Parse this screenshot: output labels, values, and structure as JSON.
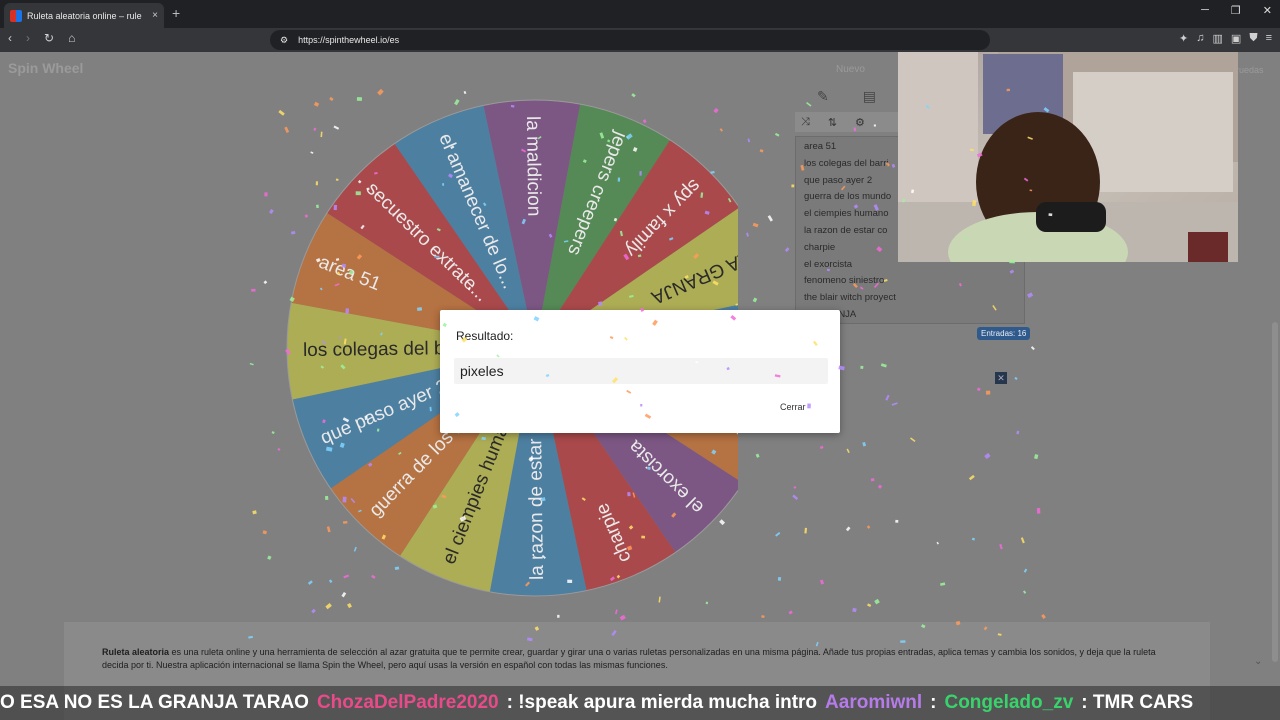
{
  "browser": {
    "tab_title": "Ruleta aleatoria online – rule",
    "url": "https://spinthewheel.io/es",
    "new_tab_glyph": "+",
    "tab_close_glyph": "×"
  },
  "page": {
    "logo": "Spin Wheel",
    "nuevo": "Nuevo",
    "ruedas": "ruedas"
  },
  "wheel": {
    "segments": [
      {
        "label": "la maldicion",
        "color": "#7a3e86"
      },
      {
        "label": "jepers creepers",
        "color": "#3a8e3a"
      },
      {
        "label": "spy x family",
        "color": "#c2282b"
      },
      {
        "label": "LA GRANJA",
        "color": "#c9c83b"
      },
      {
        "label": "pixeles",
        "color": "#2e7fb5"
      },
      {
        "label": "fenomeno siniestro",
        "color": "#d6691c"
      },
      {
        "label": "el exorcista",
        "color": "#7a3e86"
      },
      {
        "label": "charpie",
        "color": "#c2282b"
      },
      {
        "label": "la razon de estar ...",
        "color": "#2e7fb5"
      },
      {
        "label": "el ciempies humano",
        "color": "#c9c83b"
      },
      {
        "label": "guerra de los mun...",
        "color": "#d6691c"
      },
      {
        "label": "que paso ayer 2",
        "color": "#2e7fb5"
      },
      {
        "label": "los colegas del b...",
        "color": "#c9c83b"
      },
      {
        "label": "area 51",
        "color": "#d6691c"
      },
      {
        "label": "secuestro extrate...",
        "color": "#c2282b"
      },
      {
        "label": "el amanecer de lo...",
        "color": "#2e7fb5"
      }
    ]
  },
  "panel": {
    "entries": [
      "area 51",
      "los colegas del barri",
      "que paso ayer 2",
      "guerra de los mundo",
      "el ciempies humano",
      "la razon de estar co",
      "charpie",
      "el exorcista",
      "fenomeno siniestro",
      "the blair witch proyect",
      "LA GRANJA"
    ],
    "count": "Entradas: 16"
  },
  "description": {
    "bold": "Ruleta aleatoria",
    "text": " es una ruleta online y una herramienta de selección al azar gratuita que te permite crear, guardar y girar una o varias ruletas personalizadas en una misma página. Añade tus propias entradas, aplica temas y cambia los sonidos, y deja que la ruleta decida por ti. Nuestra aplicación internacional se llama Spin the Wheel, pero aquí usas la versión en español con todas las mismas funciones."
  },
  "dialog": {
    "title": "Resultado:",
    "result": "pixeles",
    "close": "Cerrar"
  },
  "chat": [
    {
      "text": "O ESA NO ES LA GRANJA TARAO",
      "color": "#ffffff"
    },
    {
      "text": "ChozaDelPadre2020",
      "color": "#e84a8a"
    },
    {
      "text": ": !speak apura mierda mucha intro",
      "color": "#ffffff"
    },
    {
      "text": "Aaromiwnl",
      "color": "#b57be8"
    },
    {
      "text": ":",
      "color": "#ffffff"
    },
    {
      "text": "Congelado_zv",
      "color": "#39d36c"
    },
    {
      "text": ": TMR CARS",
      "color": "#ffffff"
    }
  ],
  "icons": [
    "back-icon",
    "forward-icon",
    "reload-icon",
    "home-icon",
    "pencil-icon",
    "clipboard-icon",
    "shuffle-icon",
    "sort-icon",
    "gear-icon",
    "emoji-icon"
  ]
}
